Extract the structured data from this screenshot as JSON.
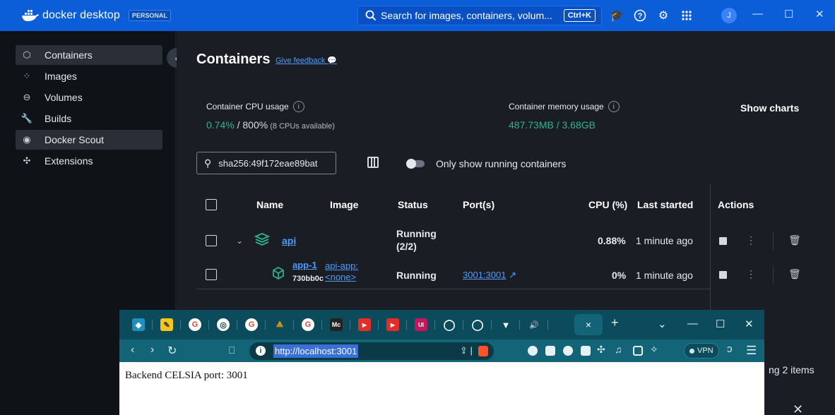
{
  "titlebar": {
    "brand_name": "docker desktop",
    "badge": "PERSONAL",
    "search_placeholder": "Search for images, containers, volum...",
    "search_shortcut": "Ctrl+K",
    "avatar_initial": "J"
  },
  "sidebar": {
    "items": [
      {
        "label": "Containers",
        "icon": "containers-icon",
        "active": true
      },
      {
        "label": "Images",
        "icon": "images-icon"
      },
      {
        "label": "Volumes",
        "icon": "volumes-icon"
      },
      {
        "label": "Builds",
        "icon": "builds-icon"
      },
      {
        "label": "Docker Scout",
        "icon": "scout-icon",
        "highlighted": true
      },
      {
        "label": "Extensions",
        "icon": "extensions-icon"
      }
    ]
  },
  "main": {
    "title": "Containers",
    "feedback": "Give feedback",
    "cpu_label": "Container CPU usage",
    "cpu_value": "0.74%",
    "cpu_total": " / 800%",
    "cpu_note": " (8 CPUs available)",
    "mem_label": "Container memory usage",
    "mem_value": "487.73MB / 3.68GB",
    "show_charts": "Show charts",
    "search_value": "sha256:49f172eae89bat",
    "toggle_label": "Only show running containers",
    "columns": {
      "name": "Name",
      "image": "Image",
      "status": "Status",
      "ports": "Port(s)",
      "cpu": "CPU (%)",
      "last_started": "Last started",
      "actions": "Actions"
    },
    "rows": [
      {
        "name": "api",
        "image": "",
        "status_1": "Running",
        "status_2": "(2/2)",
        "ports": "",
        "cpu": "0.88%",
        "last_started": "1 minute ago"
      },
      {
        "name": "app-1",
        "image_1": "api-app:",
        "image_2": "<none>",
        "image_id": "730bb0c",
        "status": "Running",
        "ports": "3001:3001",
        "cpu": "0%",
        "last_started": "1 minute ago"
      }
    ],
    "footer_fragment": "ng 2 items"
  },
  "browser": {
    "url": "http://localhost:3001",
    "vpn": "VPN",
    "page_text": "Backend CELSIA port: 3001",
    "tab_close": "×",
    "new_tab": "+"
  },
  "colors": {
    "docker_blue": "#0b5ed7",
    "running_green": "#2fb38e",
    "link_blue": "#4f9cff",
    "browser_teal": "#0b4b5c"
  }
}
